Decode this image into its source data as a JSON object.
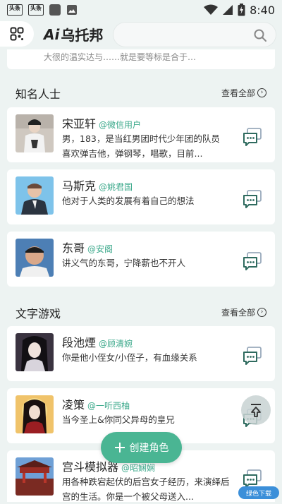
{
  "status_bar": {
    "badges": [
      "头条",
      "头条"
    ],
    "time": "8:40"
  },
  "header": {
    "logo_prefix": "Ai",
    "logo_text": "乌托邦",
    "search_placeholder": ""
  },
  "cutoff_text": "大很的温实达与……就是要等标是合于…",
  "sections": {
    "famous": {
      "title": "知名人士",
      "see_all": "查看全部",
      "items": [
        {
          "name": "宋亚轩",
          "handle": "@微信用户",
          "desc": "男，183，是当红男团时代少年团的队员 喜欢弹吉他，弹钢琴，唱歌，目前..."
        },
        {
          "name": "马斯克",
          "handle": "@姚君国",
          "desc": "他对于人类的发展有着自己的想法"
        },
        {
          "name": "东哥",
          "handle": "@安阁",
          "desc": "讲义气的东哥，宁降薪也不开人"
        }
      ]
    },
    "text_games": {
      "title": "文字游戏",
      "see_all": "查看全部",
      "items": [
        {
          "name": "段池煙",
          "handle": "@顾清婉",
          "desc": "你是他小侄女/小侄子，有血缘关系"
        },
        {
          "name": "凌策",
          "handle": "@一听西柚",
          "desc": "当今圣上&你同父异母的皇兄"
        },
        {
          "name": "宫斗模拟器",
          "handle": "@昭娴娴",
          "desc": "用各种跌宕起伏的后宫女子经历，来演绎后宫的生活。你是一个被父母送入..."
        }
      ]
    }
  },
  "fab": {
    "create_label": "创建角色"
  },
  "watermark": "绿色下载",
  "colors": {
    "accent": "#4ab593",
    "handle": "#3aa88a",
    "background": "#edf3f2"
  }
}
